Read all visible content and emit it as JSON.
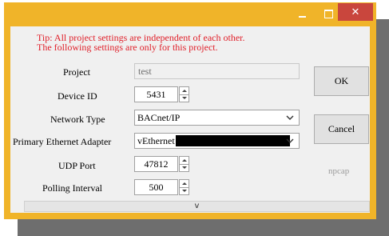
{
  "window": {
    "minimize_icon": "minimize-icon",
    "maximize_icon": "maximize-icon",
    "close_glyph": "✕",
    "accent_color": "#f0b429",
    "close_color": "#c9463d"
  },
  "tip": {
    "line1": "Tip: All project settings are independent of each other.",
    "line2": "The following settings are only for this project.",
    "color": "#e0202a"
  },
  "form": {
    "project_label": "Project",
    "project_value": "test",
    "device_id_label": "Device ID",
    "device_id_value": "5431",
    "network_type_label": "Network Type",
    "network_type_value": "BACnet/IP",
    "adapter_label": "Primary Ethernet Adapter",
    "adapter_value": "vEthernet",
    "udp_port_label": "UDP Port",
    "udp_port_value": "47812",
    "polling_label": "Polling Interval",
    "polling_value": "500"
  },
  "buttons": {
    "ok": "OK",
    "cancel": "Cancel"
  },
  "npcap_text": "npcap",
  "expander_glyph": "v"
}
